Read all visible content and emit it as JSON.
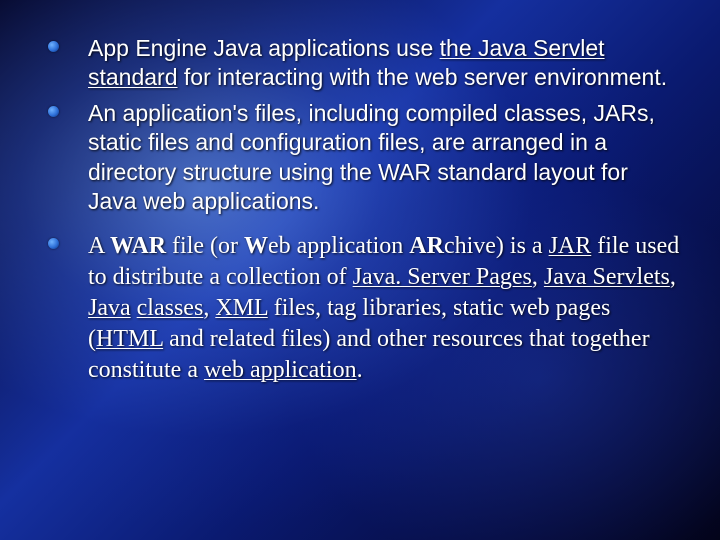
{
  "bullets": [
    {
      "prefix": "App Engine Java applications use ",
      "link1": "the Java Servlet standard",
      "suffix1": " for interacting with the web server environment."
    },
    {
      "text": "An application's files, including compiled classes, JARs, static files and configuration files, are arranged in a directory structure using the WAR standard layout for Java web applications."
    },
    {
      "p1": "A ",
      "b1": "WAR",
      "p2": " file (or ",
      "b2": "W",
      "p3": "eb application ",
      "b3": "AR",
      "p4": "chive) is a ",
      "l1": "JAR",
      "p5": " file used to distribute a collection of ",
      "l2": "Java. Server Pages",
      "p6": ", ",
      "l3": "Java Servlets",
      "p7": ", ",
      "l4": "Java",
      "p8": " ",
      "l5": "classes",
      "p9": ", ",
      "l6": "XML",
      "p10": " files, tag libraries, static web pages (",
      "l7": "HTML",
      "p11": " and related files) and other resources that together constitute a ",
      "l8": "web application",
      "p12": "."
    }
  ]
}
